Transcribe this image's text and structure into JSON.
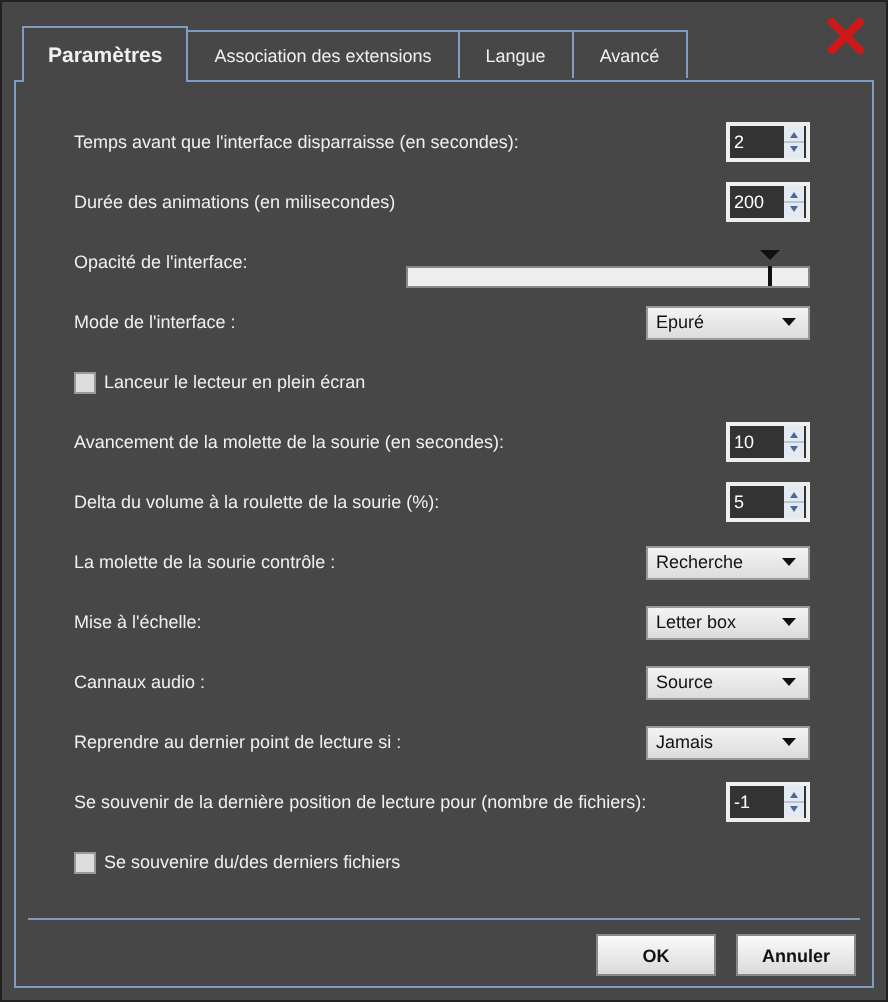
{
  "tabs": [
    {
      "label": "Paramètres",
      "selected": true
    },
    {
      "label": "Association des extensions",
      "selected": false
    },
    {
      "label": "Langue",
      "selected": false
    },
    {
      "label": "Avancé",
      "selected": false
    }
  ],
  "settings": [
    {
      "kind": "spinner",
      "label": "Temps avant que l'interface disparraisse (en secondes):",
      "value": "2"
    },
    {
      "kind": "spinner",
      "label": "Durée des animations (en milisecondes)",
      "value": "200"
    },
    {
      "kind": "slider",
      "label": "Opacité de l'interface:",
      "level": 0.9
    },
    {
      "kind": "dropdown",
      "label": "Mode de l'interface :",
      "value": "Epuré"
    },
    {
      "kind": "checkbox",
      "label": "Lanceur le lecteur en plein écran",
      "checked": false
    },
    {
      "kind": "spinner",
      "label": "Avancement de la molette de la sourie (en secondes):",
      "value": "10"
    },
    {
      "kind": "spinner",
      "label": "Delta du volume à la roulette de la sourie (%):",
      "value": "5"
    },
    {
      "kind": "dropdown",
      "label": "La molette de la sourie contrôle :",
      "value": "Recherche"
    },
    {
      "kind": "dropdown",
      "label": "Mise à l'échelle:",
      "value": "Letter box"
    },
    {
      "kind": "dropdown",
      "label": "Cannaux audio :",
      "value": "Source"
    },
    {
      "kind": "dropdown",
      "label": "Reprendre au dernier point de lecture si :",
      "value": "Jamais"
    },
    {
      "kind": "spinner",
      "label": "Se souvenir de la dernière position de lecture pour (nombre de fichiers):",
      "value": "-1"
    },
    {
      "kind": "checkbox",
      "label": "Se souvenire du/des derniers fichiers",
      "checked": false
    }
  ],
  "buttons": [
    "OK",
    "Annuler"
  ]
}
